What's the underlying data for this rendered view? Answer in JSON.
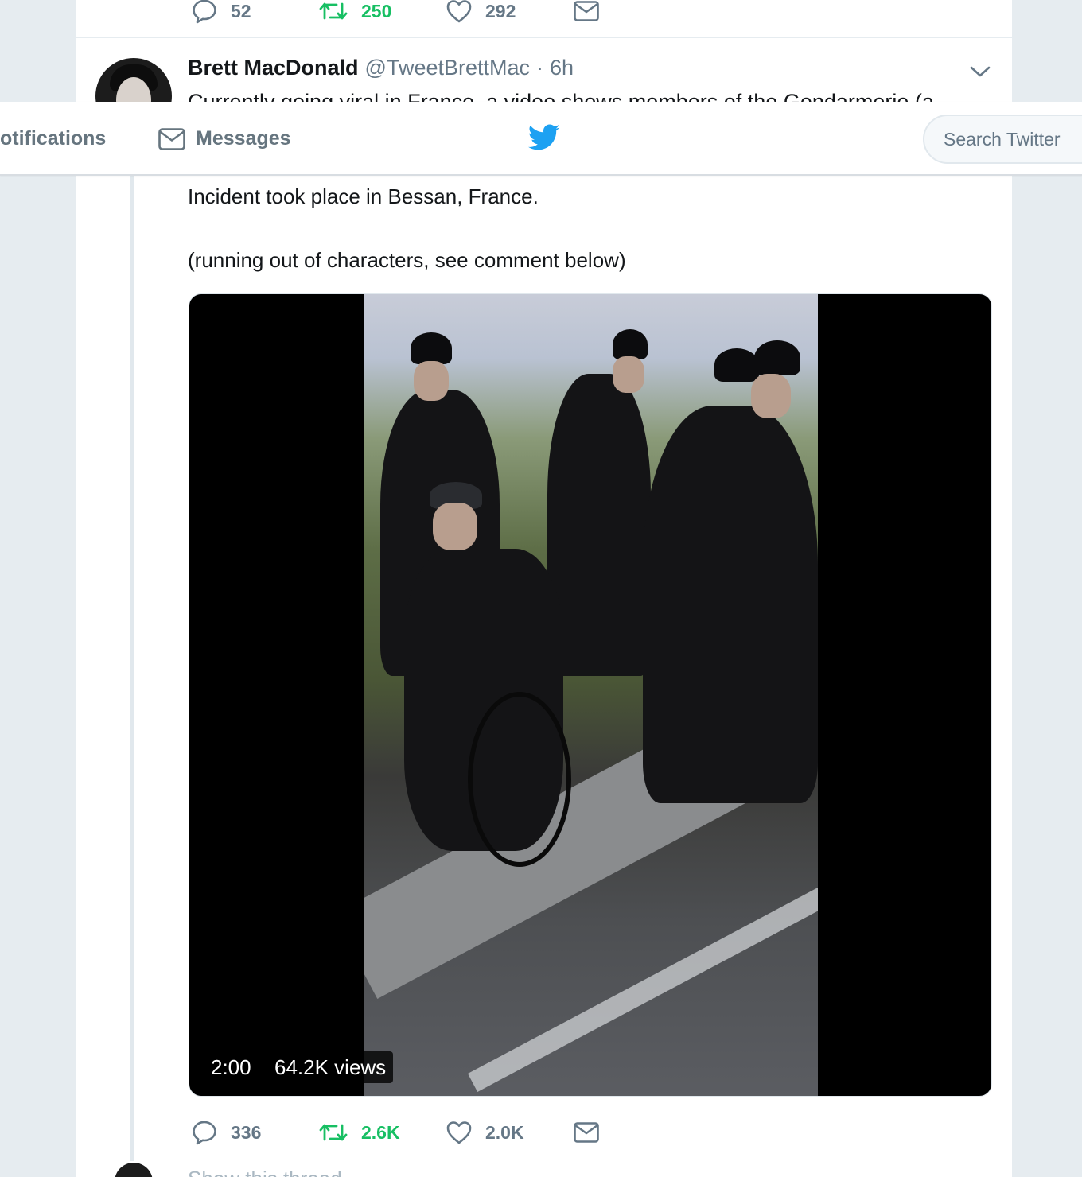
{
  "top_tweet_actions": {
    "reply_count": "52",
    "retweet_count": "250",
    "like_count": "292"
  },
  "tweet": {
    "author_name": "Brett MacDonald",
    "handle": "@TweetBrettMac",
    "separator": "·",
    "time": "6h",
    "clipped_text": "Currently going viral in France, a video shows members of the Gendarmerie (a",
    "line1": "Incident took place in Bessan, France.",
    "line2": "(running out of characters, see comment below)",
    "video": {
      "duration": "2:00",
      "views": "64.2K views"
    },
    "actions": {
      "reply_count": "336",
      "retweet_count": "2.6K",
      "like_count": "2.0K"
    }
  },
  "nav": {
    "notifications_label": "otifications",
    "messages_label": "Messages",
    "search_placeholder": "Search Twitter"
  },
  "reply_hint": "Show this thread",
  "colors": {
    "brand_blue": "#1da1f2",
    "retweet_green": "#17bf63",
    "muted_gray": "#657786"
  }
}
